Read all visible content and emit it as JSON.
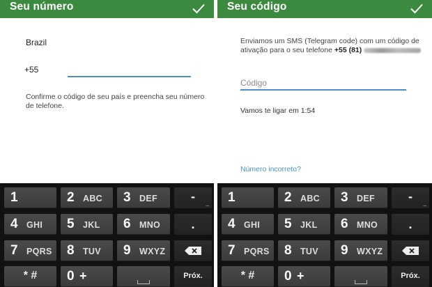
{
  "left": {
    "title": "Seu número",
    "country": "Brazil",
    "country_code": "+55",
    "phone_value": "",
    "hint": "Confirme o código de seu país e preencha seu número de telefone."
  },
  "right": {
    "title": "Seu código",
    "sms_text": "Enviamos um SMS (Telegram code) com um código de ativação para o seu telefone",
    "sms_number": "+55 (81)",
    "code_placeholder": "Código",
    "timer": "Vamos te ligar em 1:54",
    "wrong_number": "Número incorreto?"
  },
  "keyboard": {
    "keys": [
      {
        "digit": "1",
        "letters": ""
      },
      {
        "digit": "2",
        "letters": "ABC"
      },
      {
        "digit": "3",
        "letters": "DEF"
      },
      {
        "digit": "4",
        "letters": "GHI"
      },
      {
        "digit": "5",
        "letters": "JKL"
      },
      {
        "digit": "6",
        "letters": "MNO"
      },
      {
        "digit": "7",
        "letters": "PQRS"
      },
      {
        "digit": "8",
        "letters": "TUV"
      },
      {
        "digit": "9",
        "letters": "WXYZ"
      },
      {
        "digit": "0",
        "letters": "+"
      }
    ],
    "dash": "-",
    "dash_mini": "_",
    "period": ".",
    "symbols": "* #",
    "next": "Próx."
  },
  "colors": {
    "appbar": "#3c8a3f",
    "accent": "#4b8fc9",
    "keyboard_bg": "#111111"
  }
}
